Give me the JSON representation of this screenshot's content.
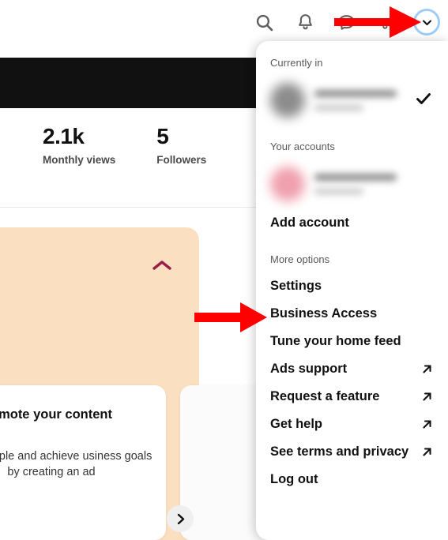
{
  "topbar": {
    "icons": [
      {
        "name": "search-icon",
        "label": "Search"
      },
      {
        "name": "bell-icon",
        "label": "Notifications"
      },
      {
        "name": "message-icon",
        "label": "Messages"
      },
      {
        "name": "megaphone-icon",
        "label": "Ads"
      }
    ],
    "account_switcher": {
      "name": "chevron-down-icon",
      "label": "Account menu",
      "ring_color": "#9fcdf5"
    }
  },
  "background": {
    "stats": [
      {
        "value": "2.1k",
        "label": "Monthly views"
      },
      {
        "value": "5",
        "label": "Followers"
      }
    ],
    "promo": {
      "collapse_icon": "chevron-up-icon",
      "panel_color": "#fae0c0",
      "accent_color": "#9c1c46",
      "title": "omote your content",
      "body": "more people and achieve usiness goals by creating an ad",
      "next_label": "Next"
    }
  },
  "dropdown": {
    "sections": [
      {
        "label": "Currently in",
        "accounts": [
          {
            "avatar_color": "#8c8c8c",
            "selected": true,
            "check_icon": "check-icon"
          }
        ]
      },
      {
        "label": "Your accounts",
        "accounts": [
          {
            "avatar_color": "#f0a0ae",
            "selected": false
          }
        ],
        "action": {
          "label": "Add account",
          "name": "add-account-item"
        }
      },
      {
        "label": "More options",
        "items": [
          {
            "label": "Settings",
            "external": false
          },
          {
            "label": "Business Access",
            "external": false
          },
          {
            "label": "Tune your home feed",
            "external": false
          },
          {
            "label": "Ads support",
            "external": true
          },
          {
            "label": "Request a feature",
            "external": true
          },
          {
            "label": "Get help",
            "external": true
          },
          {
            "label": "See terms and privacy",
            "external": true
          },
          {
            "label": "Log out",
            "external": false
          }
        ]
      }
    ]
  },
  "annotations": {
    "color": "#fe0000",
    "arrows": [
      {
        "name": "arrow-to-account-switcher",
        "points_to": "account switcher chevron"
      },
      {
        "name": "arrow-to-settings",
        "points_to": "Settings menu item"
      }
    ]
  }
}
